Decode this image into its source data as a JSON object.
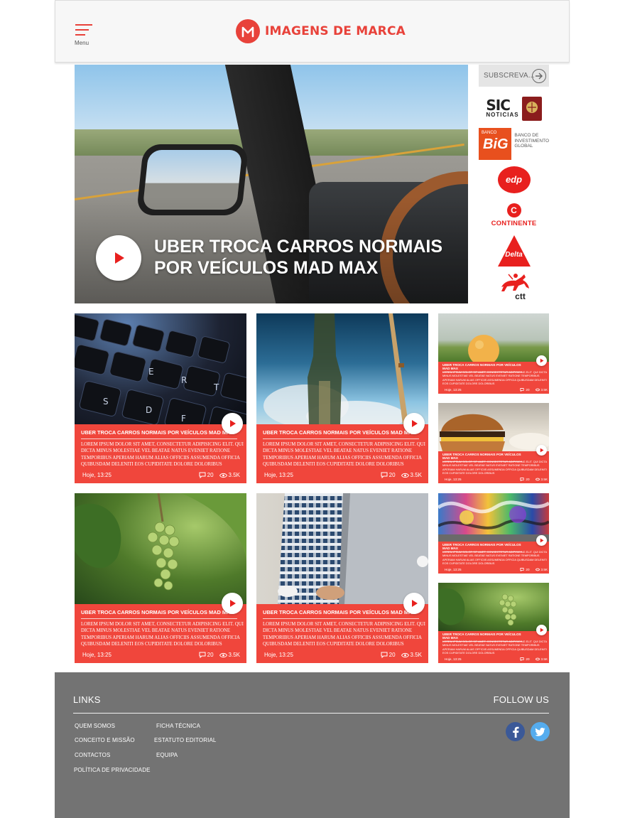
{
  "header": {
    "menu_label": "Menu",
    "brand_name": "IMAGENS DE MARCA",
    "brand_color": "#e8423a"
  },
  "hero": {
    "title_line1": "UBER TROCA CARROS NORMAIS",
    "title_line2": "POR VEÍCULOS MAD MAX",
    "image": "car-interior-mirror-road",
    "play_icon": "play-icon"
  },
  "sidebar": {
    "subscribe_label": "SUBSCREVA...",
    "subscribe_icon": "arrow-right-circle-icon",
    "sponsors": [
      {
        "name": "SIC Notícias",
        "text": "SIC",
        "subtext": "NOTICIAS"
      },
      {
        "name": "Banco BiG",
        "text_small": "BANCO",
        "text": "BiG",
        "subtext": "BANCO DE INVESTIMENTO GLOBAL"
      },
      {
        "name": "EDP",
        "text": "edp"
      },
      {
        "name": "Continente",
        "icon_text": "C",
        "text": "CONTINENTE"
      },
      {
        "name": "Delta",
        "text": "Delta"
      },
      {
        "name": "CTT",
        "text": "ctt"
      }
    ]
  },
  "cards": [
    {
      "title": "UBER TROCA CARROS NORMAIS POR VEÍCULOS MAD MAX",
      "excerpt": "Lorem ipsum dolor sit amet, consectetur adipisicing elit. Qui dicta minus molestiae vel beatae natus eveniet ratione temporibus aperiam harum alias officiis assumenda officia quibusdam deleniti eos cupiditate dolore doloribus",
      "date": "Hoje, 13:25",
      "comments": "20",
      "views": "3.5K",
      "image": "keyboard"
    },
    {
      "title": "UBER TROCA CARROS NORMAIS POR VEÍCULOS MAD MAX",
      "excerpt": "Lorem ipsum dolor sit amet, consectetur adipisicing elit. Qui dicta minus molestiae vel beatae natus eveniet ratione temporibus aperiam harum alias officiis assumenda officia quibusdam deleniti eos cupiditate dolore doloribus",
      "date": "Hoje, 13:25",
      "comments": "20",
      "views": "3.5K",
      "image": "bottle-sky"
    },
    {
      "title": "UBER TROCA CARROS NORMAIS POR VEÍCULOS MAD MAX",
      "excerpt": "Lorem ipsum dolor sit amet, consectetur adipisicing elit. Qui dicta minus molestiae vel beatae natus eveniet ratione temporibus aperiam harum alias officiis assumenda officia quibusdam deleniti eos cupiditate dolore doloribus",
      "date": "Hoje, 13:25",
      "comments": "20",
      "views": "3.5K",
      "image": "grapes"
    },
    {
      "title": "UBER TROCA CARROS NORMAIS POR VEÍCULOS MAD MAX",
      "excerpt": "Lorem ipsum dolor sit amet, consectetur adipisicing elit. Qui dicta minus molestiae vel beatae natus eveniet ratione temporibus aperiam harum alias officiis assumenda officia quibusdam deleniti eos cupiditate dolore doloribus",
      "date": "Hoje, 13:25",
      "comments": "20",
      "views": "3.5K",
      "image": "laptop-person"
    }
  ],
  "small_cards": [
    {
      "title": "UBER TROCA CARROS NORMAIS POR VEÍCULOS MAD MAX",
      "excerpt": "Lorem ipsum dolor sit amet, consectetur adipisicing elit. Qui dicta minus molestiae vel beatae natus eveniet ratione temporibus aperiam harum alias officiis assumenda officia quibusdam deleniti eos cupiditate dolore doloribus",
      "date": "Hoje, 13:25",
      "comments": "20",
      "views": "3.5K",
      "image": "orange"
    },
    {
      "title": "UBER TROCA CARROS NORMAIS POR VEÍCULOS MAD MAX",
      "excerpt": "Lorem ipsum dolor sit amet, consectetur adipisicing elit. Qui dicta minus molestiae vel beatae natus eveniet ratione temporibus aperiam harum alias officiis assumenda officia quibusdam deleniti eos cupiditate dolore doloribus",
      "date": "Hoje, 13:25",
      "comments": "20",
      "views": "3.5K",
      "image": "burger"
    },
    {
      "title": "UBER TROCA CARROS NORMAIS POR VEÍCULOS MAD MAX",
      "excerpt": "Lorem ipsum dolor sit amet, consectetur adipisicing elit. Qui dicta minus molestiae vel beatae natus eveniet ratione temporibus aperiam harum alias officiis assumenda officia quibusdam deleniti eos cupiditate dolore doloribus",
      "date": "Hoje, 13:25",
      "comments": "20",
      "views": "3.5K",
      "image": "graffiti"
    },
    {
      "title": "UBER TROCA CARROS NORMAIS POR VEÍCULOS MAD MAX",
      "excerpt": "Lorem ipsum dolor sit amet, consectetur adipisicing elit. Qui dicta minus molestiae vel beatae natus eveniet ratione temporibus aperiam harum alias officiis assumenda officia quibusdam deleniti eos cupiditate dolore doloribus",
      "date": "Hoje, 13:25",
      "comments": "20",
      "views": "3.5K",
      "image": "grapes"
    }
  ],
  "footer": {
    "links_title": "LINKS",
    "follow_title": "FOLLOW US",
    "links_col1": [
      "QUEM SOMOS",
      "CONCEITO E MISSÃO",
      "CONTACTOS",
      "POLÍTICA DE PRIVACIDADE"
    ],
    "links_col2": [
      "FICHA TÉCNICA",
      "ESTATUTO EDITORIAL",
      "EQUIPA"
    ],
    "social": [
      {
        "name": "facebook-icon",
        "glyph": "f",
        "color": "#3b5998"
      },
      {
        "name": "twitter-icon",
        "glyph": "t",
        "color": "#55acee"
      }
    ],
    "background_color": "#737373"
  }
}
